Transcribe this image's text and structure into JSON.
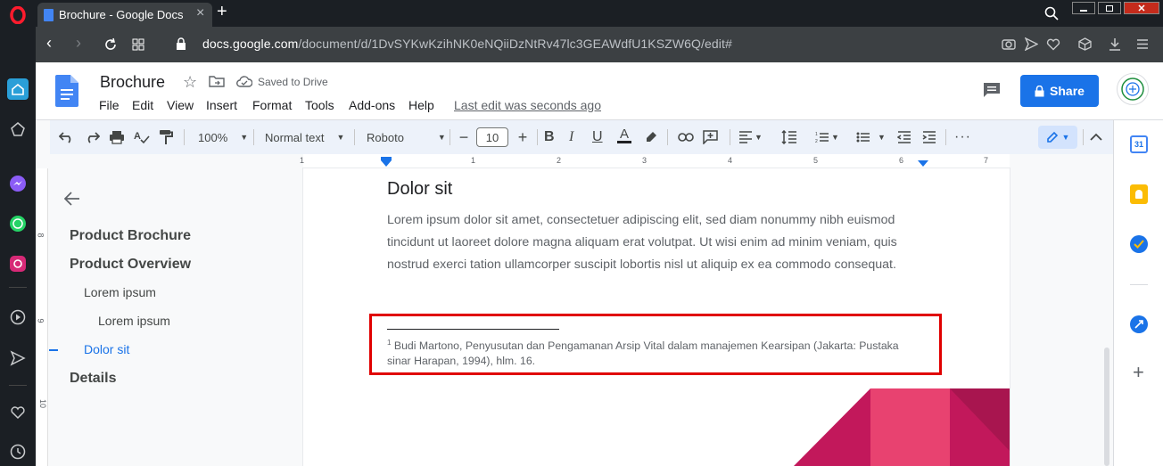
{
  "browser": {
    "tab_title": "Brochure - Google Docs",
    "url_domain": "docs.google.com",
    "url_path": "/document/d/1DvSYKwKzihNK0eNQiiDzNtRv47lc3GEAWdfU1KSZW6Q/edit#"
  },
  "docs": {
    "title": "Brochure",
    "saved_status": "Saved to Drive",
    "menu": [
      "File",
      "Edit",
      "View",
      "Insert",
      "Format",
      "Tools",
      "Add-ons",
      "Help"
    ],
    "last_edit": "Last edit was seconds ago",
    "share_label": "Share"
  },
  "toolbar": {
    "zoom": "100%",
    "style": "Normal text",
    "font": "Roboto",
    "font_size": "10"
  },
  "ruler": {
    "numbers": [
      "1",
      "1",
      "2",
      "3",
      "4",
      "5",
      "6",
      "7"
    ]
  },
  "outline": {
    "items": [
      {
        "label": "Product Brochure"
      },
      {
        "label": "Product Overview"
      },
      {
        "label": "Lorem ipsum"
      },
      {
        "label": "Lorem ipsum"
      },
      {
        "label": "Dolor sit"
      },
      {
        "label": "Details"
      }
    ]
  },
  "page": {
    "heading": "Dolor sit",
    "body": "Lorem ipsum dolor sit amet, consectetuer adipiscing elit, sed diam nonummy nibh euismod tincidunt ut laoreet dolore magna aliquam erat volutpat. Ut wisi enim ad minim veniam, quis nostrud exerci tation ullamcorper suscipit lobortis nisl ut aliquip ex ea commodo consequat.",
    "footnote_mark": "1",
    "footnote": "Budi Martono, Penyusutan dan Pengamanan Arsip Vital dalam manajemen Kearsipan (Jakarta: Pustaka sinar Harapan, 1994), hlm. 16."
  },
  "vruler": {
    "numbers": [
      "8",
      "9",
      "10"
    ]
  },
  "colors": {
    "accent": "#1a73e8",
    "highlight": "#e00000",
    "decor_pink": "#e84270",
    "decor_dark": "#c2185b"
  }
}
